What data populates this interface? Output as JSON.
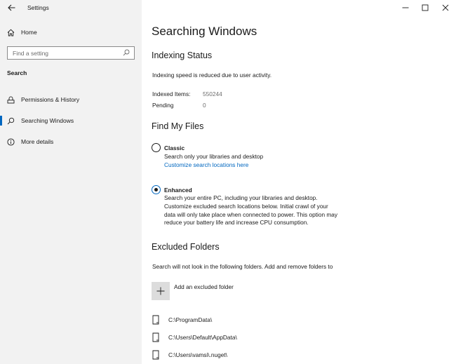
{
  "window": {
    "title": "Settings"
  },
  "sidebar": {
    "home_label": "Home",
    "search_placeholder": "Find a setting",
    "section_label": "Search",
    "items": [
      {
        "label": "Permissions & History",
        "icon": "permissions-icon"
      },
      {
        "label": "Searching Windows",
        "icon": "search-icon",
        "active": true
      },
      {
        "label": "More details",
        "icon": "info-icon"
      }
    ]
  },
  "main": {
    "title": "Searching Windows",
    "indexing": {
      "heading": "Indexing Status",
      "message": "Indexing speed is reduced due to user activity.",
      "indexed_label": "Indexed Items:",
      "indexed_value": "550244",
      "pending_label": "Pending",
      "pending_value": "0"
    },
    "find_my_files": {
      "heading": "Find My Files",
      "classic_title": "Classic",
      "classic_desc": "Search only your libraries and desktop",
      "classic_link": "Customize search locations here",
      "enhanced_title": "Enhanced",
      "enhanced_desc_lines": [
        "Search your entire PC, including your libraries and desktop.",
        "Customize excluded search locations below. Initial crawl of your",
        "data will only take place when connected to power. This option may",
        "reduce your battery life and increase CPU consumption."
      ],
      "selected": "Enhanced"
    },
    "excluded": {
      "heading": "Excluded Folders",
      "description": "Search will not look in the following folders. Add and remove folders to",
      "add_label": "Add an excluded folder",
      "folders": [
        "C:\\ProgramData\\",
        "C:\\Users\\Default\\AppData\\",
        "C:\\Users\\vamsi\\.nuget\\"
      ]
    }
  },
  "colors": {
    "accent": "#0067c0",
    "sidebar_bg": "#f2f2f2",
    "muted_text": "#6d6d6d"
  }
}
